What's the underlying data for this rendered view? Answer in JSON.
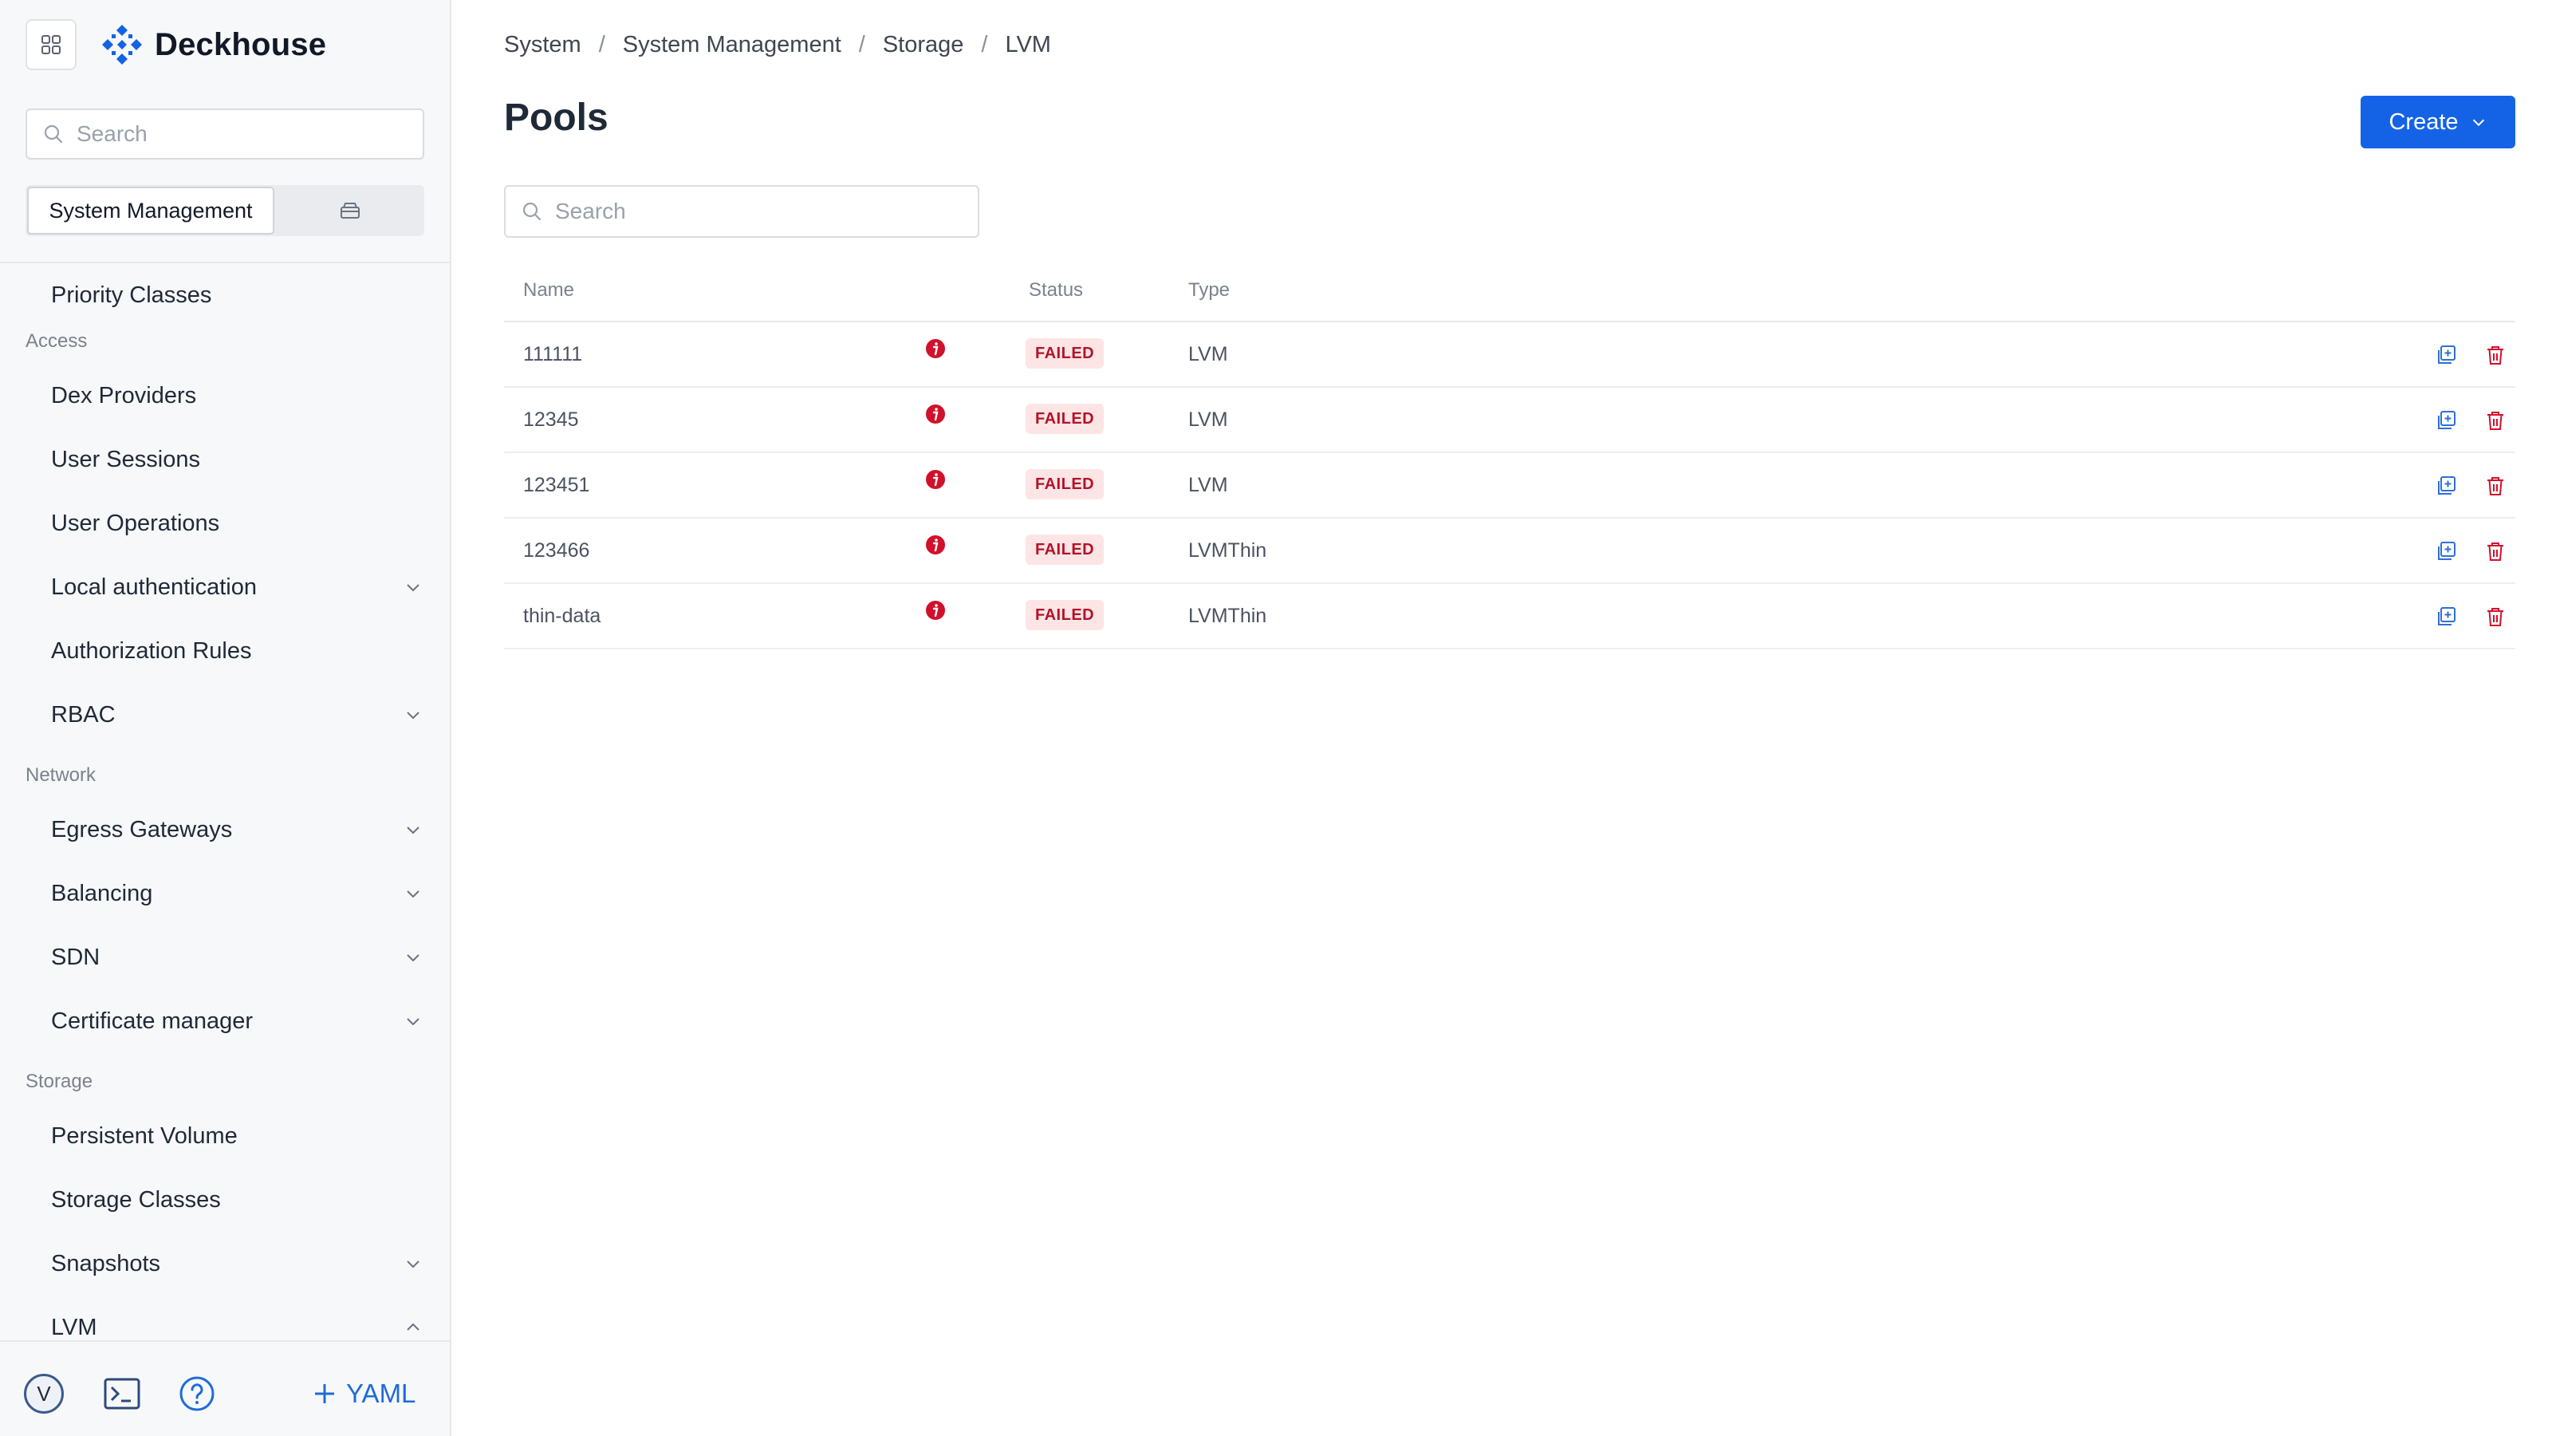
{
  "app": {
    "name": "Deckhouse",
    "brand_color": "#1463e6"
  },
  "sidebar": {
    "search_placeholder": "Search",
    "segment_active_label": "System Management",
    "segment_other_icon": "archive-icon",
    "sections": [
      {
        "type": "item",
        "label": "Priority Classes",
        "expandable": false
      },
      {
        "type": "group",
        "label": "Access"
      },
      {
        "type": "item",
        "label": "Dex Providers",
        "expandable": false
      },
      {
        "type": "item",
        "label": "User Sessions",
        "expandable": false
      },
      {
        "type": "item",
        "label": "User Operations",
        "expandable": false
      },
      {
        "type": "item",
        "label": "Local authentication",
        "expandable": true,
        "expanded": false
      },
      {
        "type": "item",
        "label": "Authorization Rules",
        "expandable": false
      },
      {
        "type": "item",
        "label": "RBAC",
        "expandable": true,
        "expanded": false
      },
      {
        "type": "group",
        "label": "Network"
      },
      {
        "type": "item",
        "label": "Egress Gateways",
        "expandable": true,
        "expanded": false
      },
      {
        "type": "item",
        "label": "Balancing",
        "expandable": true,
        "expanded": false
      },
      {
        "type": "item",
        "label": "SDN",
        "expandable": true,
        "expanded": false
      },
      {
        "type": "item",
        "label": "Certificate manager",
        "expandable": true,
        "expanded": false
      },
      {
        "type": "group",
        "label": "Storage"
      },
      {
        "type": "item",
        "label": "Persistent Volume",
        "expandable": false
      },
      {
        "type": "item",
        "label": "Storage Classes",
        "expandable": false
      },
      {
        "type": "item",
        "label": "Snapshots",
        "expandable": true,
        "expanded": false
      },
      {
        "type": "item",
        "label": "LVM",
        "expandable": true,
        "expanded": true
      }
    ],
    "bottom": {
      "avatar_letter": "V",
      "terminal_icon": "terminal-icon",
      "help_icon": "help-icon",
      "yaml_label": "YAML"
    }
  },
  "breadcrumb": [
    "System",
    "System Management",
    "Storage",
    "LVM"
  ],
  "page": {
    "title": "Pools",
    "create_label": "Create",
    "search_placeholder": "Search"
  },
  "table": {
    "columns": {
      "name": "Name",
      "status": "Status",
      "type": "Type"
    },
    "rows": [
      {
        "name": "111111",
        "status": "FAILED",
        "type": "LVM"
      },
      {
        "name": "12345",
        "status": "FAILED",
        "type": "LVM"
      },
      {
        "name": "123451",
        "status": "FAILED",
        "type": "LVM"
      },
      {
        "name": "123466",
        "status": "FAILED",
        "type": "LVMThin"
      },
      {
        "name": "thin-data",
        "status": "FAILED",
        "type": "LVMThin"
      }
    ],
    "status_color": "#b3122a",
    "status_bg": "#fde5e5"
  }
}
